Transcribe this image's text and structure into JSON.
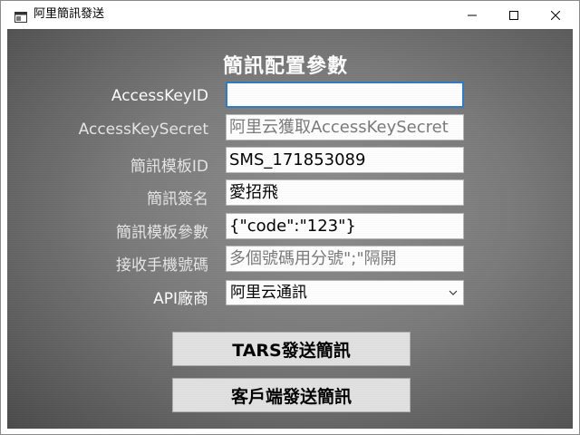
{
  "window": {
    "title": "阿里簡訊發送",
    "icon": "app-window-icon",
    "controls": [
      "minimize-icon",
      "maximize-icon",
      "close-icon"
    ]
  },
  "form": {
    "heading": "簡訊配置參數",
    "fields": [
      {
        "label": "AccessKeyID",
        "value": "",
        "placeholder": ""
      },
      {
        "label": "AccessKeySecret",
        "value": "",
        "placeholder": "阿里云獲取AccessKeySecret"
      },
      {
        "label": "簡訊模板ID",
        "value": "SMS_171853089",
        "placeholder": ""
      },
      {
        "label": "簡訊簽名",
        "value": "愛招飛",
        "placeholder": ""
      },
      {
        "label": "簡訊模板參數",
        "value": "{\"code\":\"123\"}",
        "placeholder": ""
      },
      {
        "label": "接收手機號碼",
        "value": "",
        "placeholder": "多個號碼用分號\";\"隔開"
      }
    ],
    "api": {
      "label": "API廠商",
      "selected": "阿里云通訊"
    }
  },
  "buttons": {
    "tars_send": "TARS發送簡訊",
    "client_send": "客戶端發送簡訊"
  },
  "colors": {
    "focus_border": "#2f7bc7",
    "button_bg": "#e1e1e1"
  }
}
